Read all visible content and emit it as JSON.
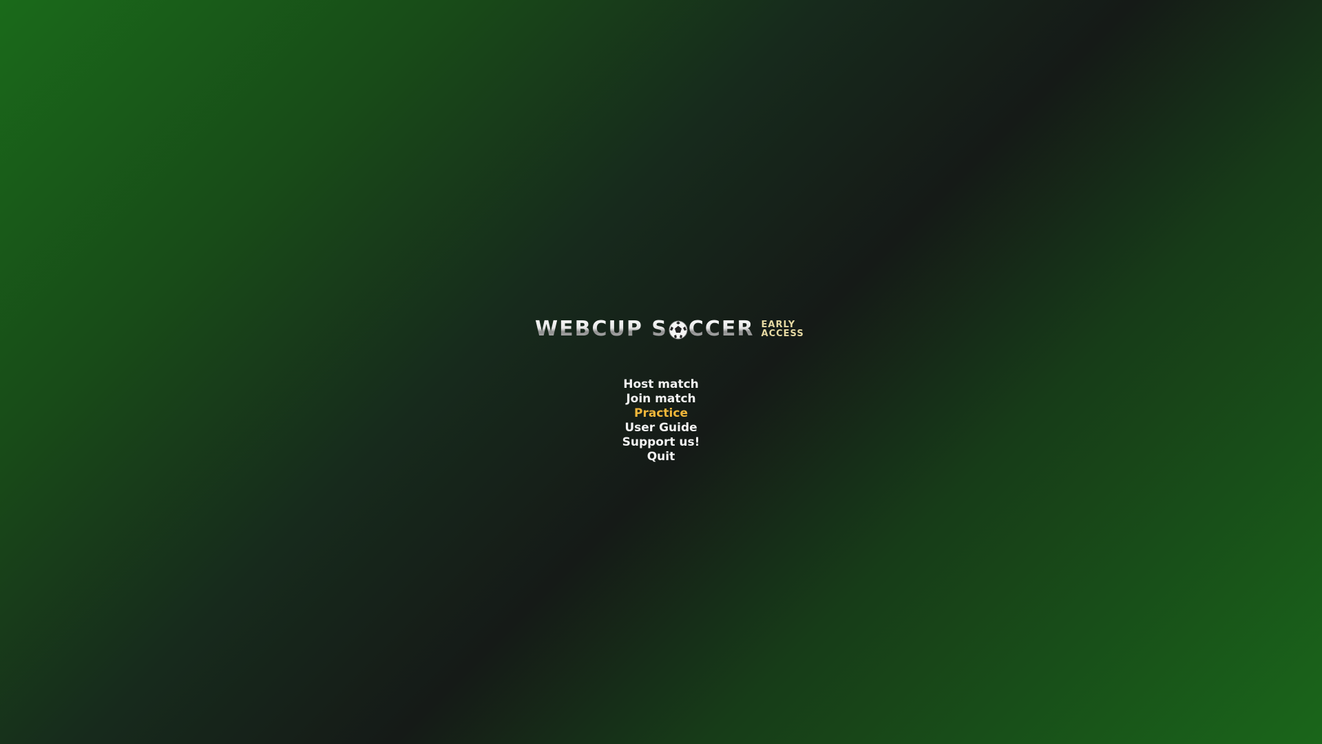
{
  "logo": {
    "part1": "WEBCUP S",
    "part2": "CCER",
    "tag_line1": "EARLY",
    "tag_line2": "ACCESS",
    "ball_icon": "soccer-ball-icon"
  },
  "menu": {
    "items": [
      {
        "label": "Host match"
      },
      {
        "label": "Join match"
      },
      {
        "label": "Practice"
      },
      {
        "label": "User Guide"
      },
      {
        "label": "Support us!"
      },
      {
        "label": "Quit"
      }
    ],
    "selected_index": 2
  },
  "colors": {
    "menu_text": "#f2f2f2",
    "menu_selected": "#f0b63a",
    "tag_text": "#e6d9a3"
  }
}
